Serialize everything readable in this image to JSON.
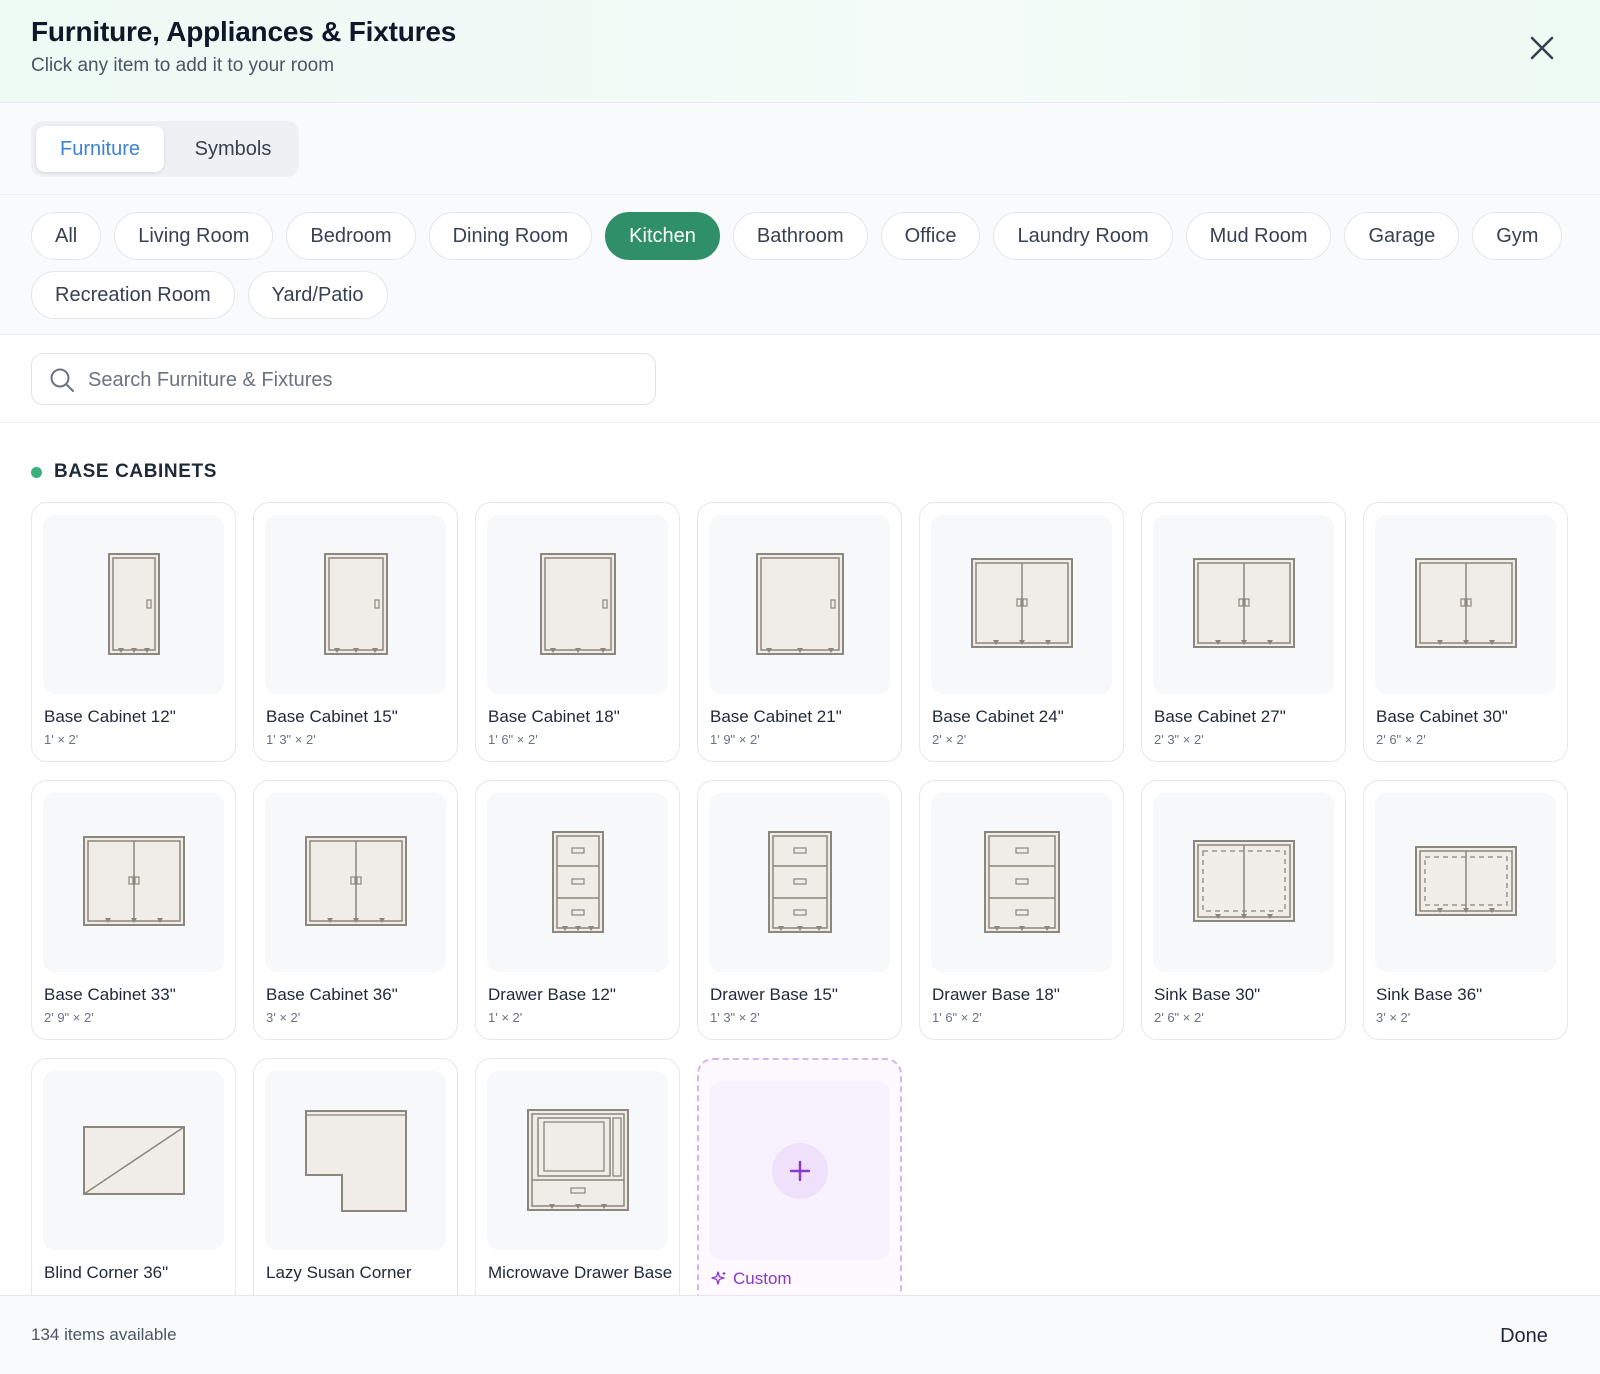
{
  "header": {
    "title": "Furniture, Appliances & Fixtures",
    "subtitle": "Click any item to add it to your room",
    "close_icon": "close-icon"
  },
  "mode_tabs": [
    {
      "label": "Furniture",
      "active": true
    },
    {
      "label": "Symbols",
      "active": false
    }
  ],
  "categories": [
    {
      "label": "All",
      "active": false
    },
    {
      "label": "Living Room",
      "active": false
    },
    {
      "label": "Bedroom",
      "active": false
    },
    {
      "label": "Dining Room",
      "active": false
    },
    {
      "label": "Kitchen",
      "active": true
    },
    {
      "label": "Bathroom",
      "active": false
    },
    {
      "label": "Office",
      "active": false
    },
    {
      "label": "Laundry Room",
      "active": false
    },
    {
      "label": "Mud Room",
      "active": false
    },
    {
      "label": "Garage",
      "active": false
    },
    {
      "label": "Gym",
      "active": false
    },
    {
      "label": "Recreation Room",
      "active": false
    },
    {
      "label": "Yard/Patio",
      "active": false
    }
  ],
  "search": {
    "placeholder": "Search Furniture & Fixtures",
    "value": "",
    "icon": "search-icon"
  },
  "section": {
    "title": "BASE CABINETS",
    "accent": "#3bb07a"
  },
  "items": [
    {
      "name": "Base Cabinet 12\"",
      "dims": "1' × 2'",
      "icon": "single-door-cabinet-icon"
    },
    {
      "name": "Base Cabinet 15\"",
      "dims": "1' 3\" × 2'",
      "icon": "single-door-cabinet-icon"
    },
    {
      "name": "Base Cabinet 18\"",
      "dims": "1' 6\" × 2'",
      "icon": "single-door-cabinet-icon"
    },
    {
      "name": "Base Cabinet 21\"",
      "dims": "1' 9\" × 2'",
      "icon": "single-door-cabinet-icon"
    },
    {
      "name": "Base Cabinet 24\"",
      "dims": "2' × 2'",
      "icon": "double-door-cabinet-icon"
    },
    {
      "name": "Base Cabinet 27\"",
      "dims": "2' 3\" × 2'",
      "icon": "double-door-cabinet-icon"
    },
    {
      "name": "Base Cabinet 30\"",
      "dims": "2' 6\" × 2'",
      "icon": "double-door-cabinet-icon"
    },
    {
      "name": "Base Cabinet 33\"",
      "dims": "2' 9\" × 2'",
      "icon": "double-door-cabinet-icon"
    },
    {
      "name": "Base Cabinet 36\"",
      "dims": "3' × 2'",
      "icon": "double-door-cabinet-icon"
    },
    {
      "name": "Drawer Base 12\"",
      "dims": "1' × 2'",
      "icon": "drawer-base-icon"
    },
    {
      "name": "Drawer Base 15\"",
      "dims": "1' 3\" × 2'",
      "icon": "drawer-base-icon"
    },
    {
      "name": "Drawer Base 18\"",
      "dims": "1' 6\" × 2'",
      "icon": "drawer-base-icon"
    },
    {
      "name": "Sink Base 30\"",
      "dims": "2' 6\" × 2'",
      "icon": "sink-base-icon"
    },
    {
      "name": "Sink Base 36\"",
      "dims": "3' × 2'",
      "icon": "sink-base-icon"
    },
    {
      "name": "Blind Corner 36\"",
      "dims": "",
      "icon": "blind-corner-icon"
    },
    {
      "name": "Lazy Susan Corner",
      "dims": "",
      "icon": "lazy-susan-icon"
    },
    {
      "name": "Microwave Drawer Base",
      "dims": "",
      "icon": "microwave-drawer-icon"
    }
  ],
  "custom": {
    "label": "Custom",
    "icon": "sparkle-icon",
    "plus_icon": "plus-icon",
    "color": "#8a38c9"
  },
  "footer": {
    "count_text": "134 items available",
    "done_label": "Done"
  },
  "colors": {
    "accent_green": "#2f8f68",
    "accent_blue": "#3b82d6",
    "icon_stroke": "#8b867e",
    "icon_fill": "#f0ede8"
  }
}
